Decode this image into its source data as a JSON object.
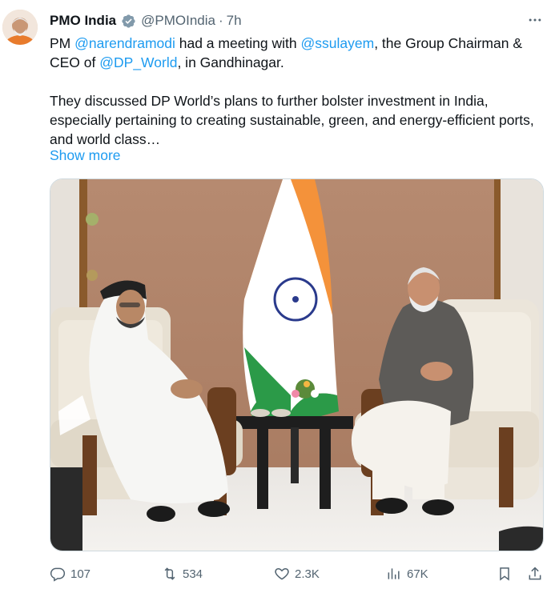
{
  "author": {
    "name": "PMO India",
    "handle": "@PMOIndia",
    "separator": "·",
    "time": "7h"
  },
  "tweet": {
    "line1_prefix": "PM ",
    "mention1": "@narendramodi",
    "line1_mid": " had a meeting with ",
    "mention2": "@ssulayem",
    "line1_suffix": ", the Group Chairman & CEO of ",
    "mention3": "@DP_World",
    "line1_end": ", in Gandhinagar.",
    "paragraph2": "They discussed DP World’s plans to further bolster investment in India, especially pertaining to creating sustainable, green, and energy-efficient ports, and world class…",
    "show_more": "Show more"
  },
  "actions": {
    "replies": "107",
    "reposts": "534",
    "likes": "2.3K",
    "views": "67K"
  },
  "colors": {
    "accent": "#1d9bf0",
    "secondary_text": "#536471",
    "flag_saffron": "#f4923a",
    "flag_green": "#2b9a48",
    "wall": "#b4856a"
  },
  "icons": {
    "verified": "verified-badge-icon",
    "more": "more-options-icon",
    "reply": "reply-icon",
    "repost": "repost-icon",
    "like": "heart-icon",
    "views": "views-chart-icon",
    "bookmark": "bookmark-icon",
    "share": "share-icon"
  }
}
